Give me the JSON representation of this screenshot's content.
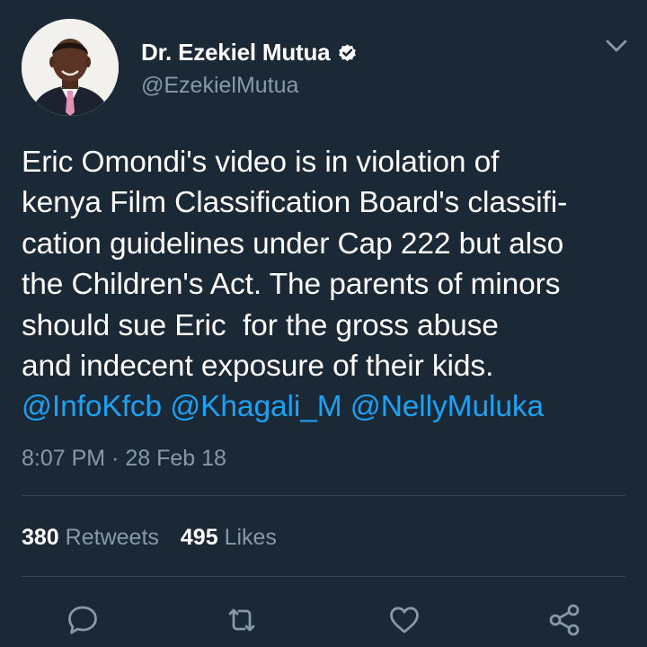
{
  "author": {
    "display_name": "Dr. Ezekiel Mutua",
    "handle": "@EzekielMutua",
    "verified": true
  },
  "tweet": {
    "lines": [
      "Eric Omondi's video is in violation of",
      "kenya Film Classification Board's classifi-",
      "cation guidelines under Cap 222 but also",
      "the Children's Act. The parents of minors",
      "should sue Eric  for the gross abuse",
      "and indecent exposure of their kids."
    ],
    "mentions": [
      "@InfoKfcb",
      "@Khagali_M",
      "@NellyMuluka"
    ],
    "timestamp": "8:07 PM · 28 Feb 18"
  },
  "stats": {
    "retweets_count": "380",
    "retweets_label": "Retweets",
    "likes_count": "495",
    "likes_label": "Likes"
  },
  "actions": {
    "icons": [
      "reply-icon",
      "retweet-icon",
      "like-icon",
      "share-icon"
    ]
  },
  "colors": {
    "background": "#1b2836",
    "text": "#ffffff",
    "secondary_text": "#8899a6",
    "link": "#1da1f2",
    "divider": "#38444d"
  }
}
